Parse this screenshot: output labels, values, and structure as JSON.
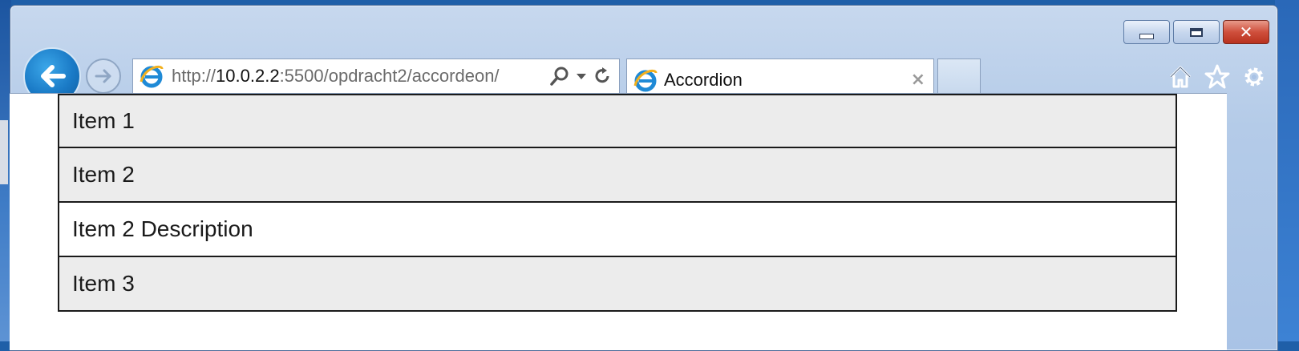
{
  "browser": {
    "address": {
      "url_prefix": "http://",
      "url_host": "10.0.2.2",
      "url_rest": ":5500/opdracht2/accordeon/"
    },
    "tab": {
      "title": "Accordion",
      "close_label": "×"
    },
    "caption": {
      "close_label": "✕"
    }
  },
  "accordion": {
    "items": [
      {
        "label": "Item 1",
        "kind": "header"
      },
      {
        "label": "Item 2",
        "kind": "header"
      },
      {
        "label": "Item 2 Description",
        "kind": "description"
      },
      {
        "label": "Item 3",
        "kind": "header"
      }
    ]
  },
  "icons": {
    "back": "back-arrow-icon",
    "forward": "forward-arrow-icon",
    "page": "internet-explorer-icon",
    "search": "search-icon",
    "dropdown": "chevron-down-icon",
    "refresh": "refresh-icon",
    "home": "home-icon",
    "favorites": "star-icon",
    "tools": "gear-icon"
  },
  "colors": {
    "accordion_header_bg": "#ececec",
    "accordion_desc_bg": "#ffffff",
    "back_button": "#1a7ac6"
  }
}
